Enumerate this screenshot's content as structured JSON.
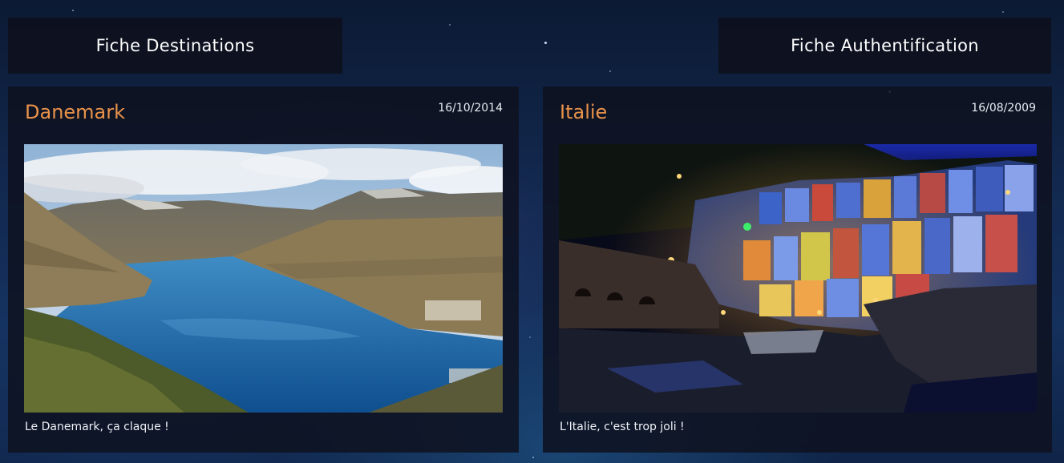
{
  "nav": {
    "destinations_label": "Fiche Destinations",
    "auth_label": "Fiche Authentification"
  },
  "cards": [
    {
      "title": "Danemark",
      "date": "16/10/2014",
      "caption": "Le Danemark, ça claque !",
      "image": "fjord-landscape-photo"
    },
    {
      "title": "Italie",
      "date": "16/08/2009",
      "caption": "L'Italie, c'est trop joli !",
      "image": "coastal-village-night-photo"
    }
  ],
  "colors": {
    "title_accent": "#e9924a",
    "card_background": "#0e1220",
    "page_background": "#132a52"
  }
}
